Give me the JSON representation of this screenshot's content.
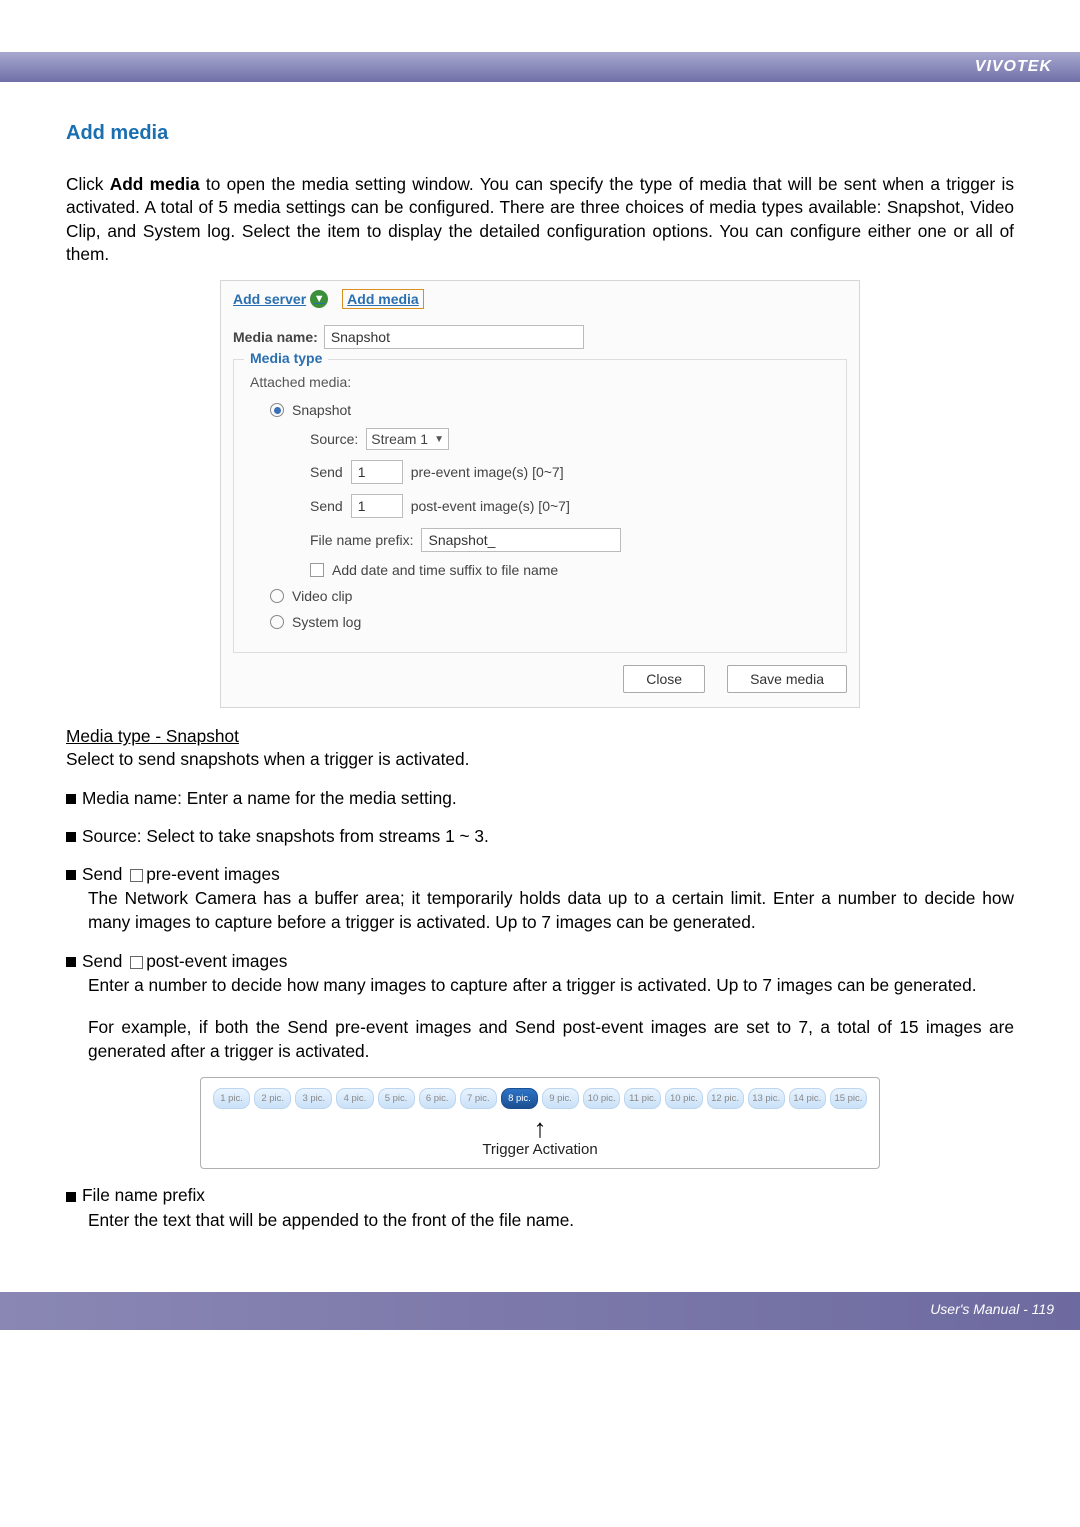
{
  "brand": "VIVOTEK",
  "section_title": "Add media",
  "intro_before_bold": "Click ",
  "intro_bold": "Add media",
  "intro_after_bold": " to open the media setting window. You can specify the type of media that will be sent when a trigger is activated. A total of 5 media settings can be configured. There are three choices of media types available: Snapshot, Video Clip, and System log. Select the item to display the detailed configuration options. You can configure either one or all of them.",
  "dialog": {
    "add_server": "Add server",
    "add_media": "Add media",
    "media_name_label": "Media name:",
    "media_name_value": "Snapshot",
    "media_type_legend": "Media type",
    "attached_label": "Attached media:",
    "radio_snapshot": "Snapshot",
    "radio_videoclip": "Video clip",
    "radio_systemlog": "System log",
    "source_label": "Source:",
    "source_value": "Stream 1",
    "send_label": "Send",
    "pre_value": "1",
    "pre_suffix": "pre-event image(s) [0~7]",
    "post_value": "1",
    "post_suffix": "post-event image(s) [0~7]",
    "prefix_label": "File name prefix:",
    "prefix_value": "Snapshot_",
    "suffix_checkbox": "Add date and time suffix to file name",
    "btn_close": "Close",
    "btn_save": "Save media"
  },
  "snapshot_heading": "Media type - Snapshot",
  "snapshot_desc": "Select to send snapshots when a trigger is activated.",
  "b_media_name": "Media name: Enter a name for the media setting.",
  "b_source": "Source: Select to take snapshots from streams 1 ~ 3.",
  "b_send_pre_label": "Send",
  "b_send_pre_after": "pre-event images",
  "b_send_pre_desc": "The Network Camera has a buffer area; it temporarily holds data up to a certain limit. Enter a number to decide how many images to capture before a trigger is activated. Up to 7 images can be generated.",
  "b_send_post_label": "Send",
  "b_send_post_after": "post-event images",
  "b_send_post_desc": "Enter a number to decide how many images to capture after a trigger is activated. Up to 7 images can be generated.",
  "example_text": "For example, if both the Send pre-event images and Send post-event images are set to 7, a total of 15 images are generated after a trigger is activated.",
  "trigger_caption": "Trigger Activation",
  "b_prefix_label": "File name prefix",
  "b_prefix_desc": "Enter the text that will be appended to the front of the file name.",
  "footer": "User's Manual - 119",
  "chart_data": {
    "type": "bar",
    "title": "Trigger Activation image sequence",
    "categories": [
      "1 pic.",
      "2 pic.",
      "3 pic.",
      "4 pic.",
      "5 pic.",
      "6 pic.",
      "7 pic.",
      "8 pic.",
      "9 pic.",
      "10 pic.",
      "11 pic.",
      "10 pic.",
      "12 pic.",
      "13 pic.",
      "14 pic.",
      "15 pic."
    ],
    "highlight_index": 7,
    "xlabel": "",
    "ylabel": ""
  },
  "pics": [
    {
      "label": "1 pic."
    },
    {
      "label": "2 pic."
    },
    {
      "label": "3 pic."
    },
    {
      "label": "4 pic."
    },
    {
      "label": "5 pic."
    },
    {
      "label": "6 pic."
    },
    {
      "label": "7 pic."
    },
    {
      "label": "8 pic.",
      "hl": true
    },
    {
      "label": "9 pic."
    },
    {
      "label": "10 pic."
    },
    {
      "label": "11 pic."
    },
    {
      "label": "10 pic."
    },
    {
      "label": "12 pic."
    },
    {
      "label": "13 pic."
    },
    {
      "label": "14 pic."
    },
    {
      "label": "15 pic."
    }
  ]
}
